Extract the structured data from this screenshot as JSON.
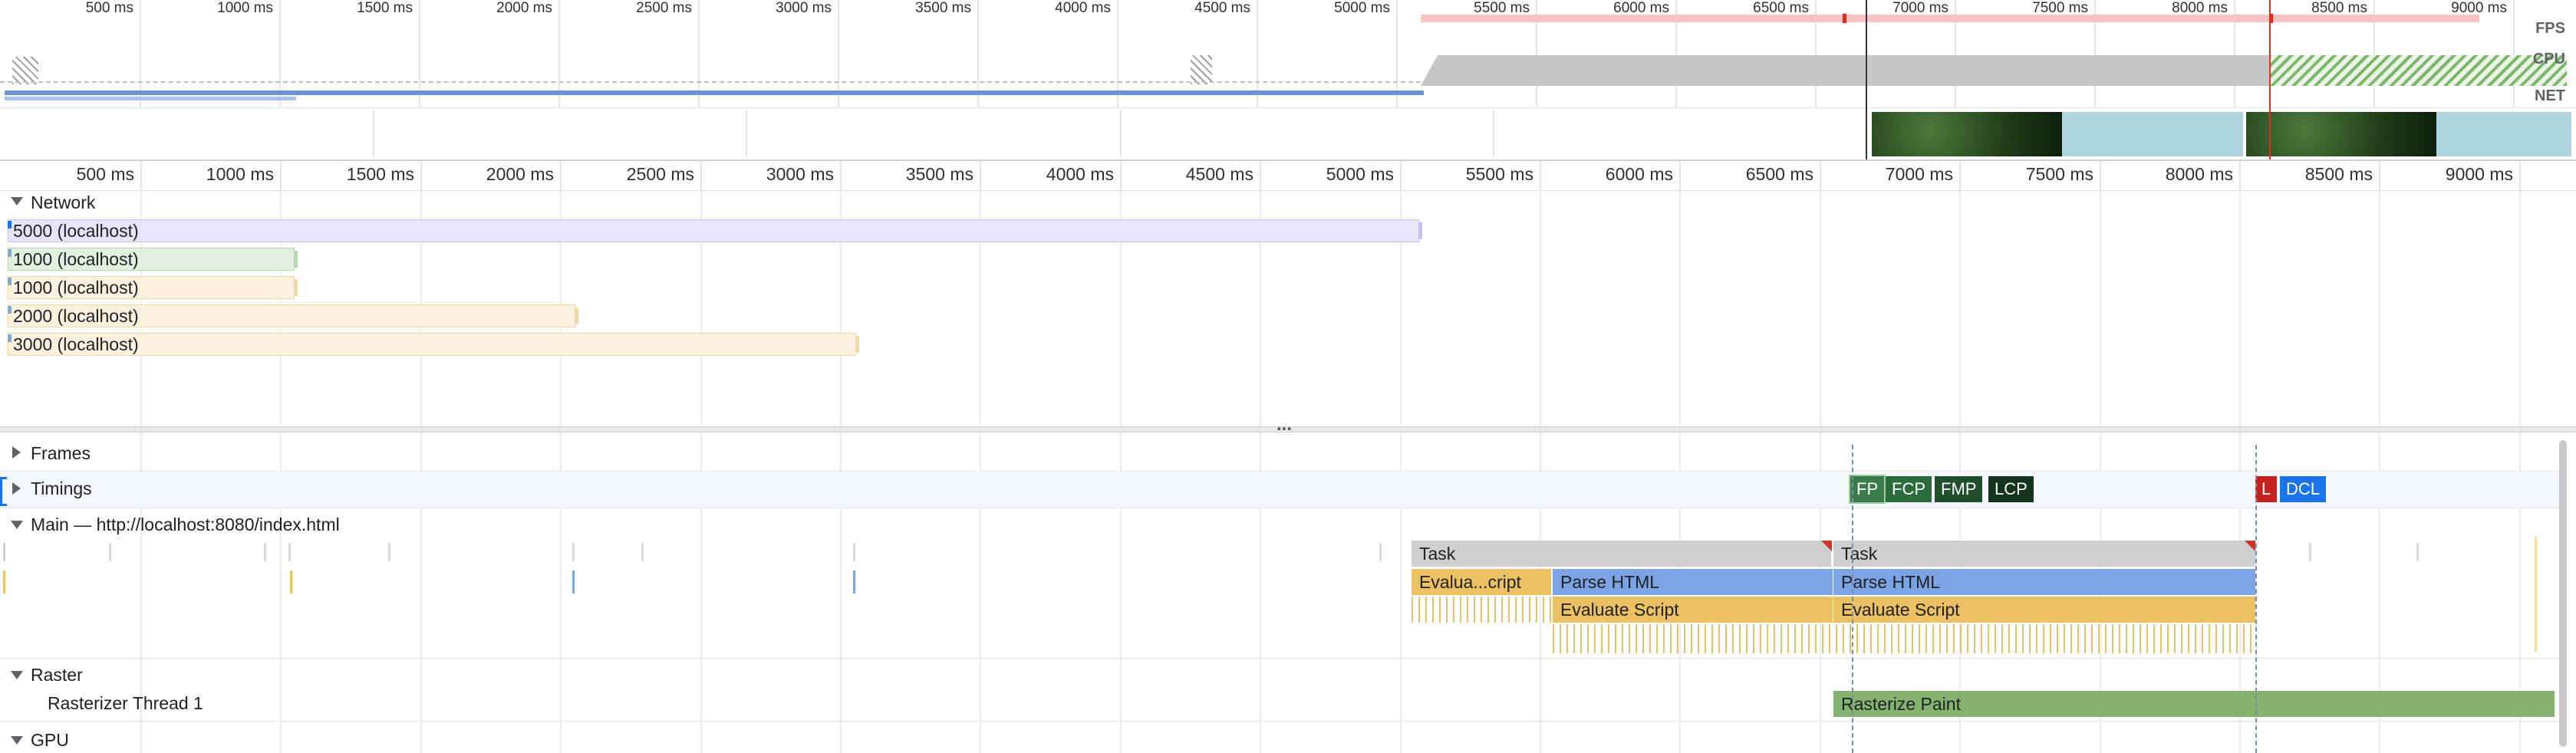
{
  "overview": {
    "ruler_labels": [
      "500 ms",
      "1000 ms",
      "1500 ms",
      "2000 ms",
      "2500 ms",
      "3000 ms",
      "3500 ms",
      "4000 ms",
      "4500 ms",
      "5000 ms",
      "5500 ms",
      "6000 ms",
      "6500 ms",
      "7000 ms",
      "7500 ms",
      "8000 ms",
      "8500 ms",
      "9000 ms"
    ],
    "fps_label": "FPS",
    "cpu_label": "CPU",
    "net_label": "NET"
  },
  "timeline_ruler": {
    "labels": [
      "500 ms",
      "1000 ms",
      "1500 ms",
      "2000 ms",
      "2500 ms",
      "3000 ms",
      "3500 ms",
      "4000 ms",
      "4500 ms",
      "5000 ms",
      "5500 ms",
      "6000 ms",
      "6500 ms",
      "7000 ms",
      "7500 ms",
      "8000 ms",
      "8500 ms",
      "9000 ms"
    ]
  },
  "network": {
    "title": "Network",
    "requests": [
      {
        "label": "5000 (localhost)",
        "color": "#e8e3f9"
      },
      {
        "label": "1000 (localhost)",
        "color": "#e2f1df"
      },
      {
        "label": "1000 (localhost)",
        "color": "#fcf1de"
      },
      {
        "label": "2000 (localhost)",
        "color": "#fcf1de"
      },
      {
        "label": "3000 (localhost)",
        "color": "#fcf1de"
      }
    ]
  },
  "splitter": {
    "handle": "..."
  },
  "tracks": {
    "frames": "Frames",
    "timings": "Timings",
    "main": "Main — http://localhost:8080/index.html",
    "raster": "Raster",
    "rasterizer_thread": "Rasterizer Thread 1",
    "gpu": "GPU"
  },
  "timings_markers": [
    {
      "label": "FP",
      "color": "#3b7b4a"
    },
    {
      "label": "FCP",
      "color": "#2c6b3c"
    },
    {
      "label": "FMP",
      "color": "#1f4f2b"
    },
    {
      "label": "LCP",
      "color": "#15341d"
    },
    {
      "label": "L",
      "color": "#c5221f"
    },
    {
      "label": "DCL",
      "color": "#1a73e8"
    }
  ],
  "main_events": {
    "task1": "Task",
    "task2": "Task",
    "evaluate_short": "Evalua...cript",
    "parse_html_1": "Parse HTML",
    "parse_html_2": "Parse HTML",
    "evaluate_script_1": "Evaluate Script",
    "evaluate_script_2": "Evaluate Script",
    "rasterize_paint": "Rasterize Paint"
  },
  "colors": {
    "task": "#cfcfcf",
    "parse_html": "#7ca4e4",
    "evaluate_script": "#ecc163",
    "rasterize": "#83b36f",
    "net_bar": "#6d93d6",
    "cpu": "#c6c6c6",
    "fps": "#f6c5c2"
  }
}
